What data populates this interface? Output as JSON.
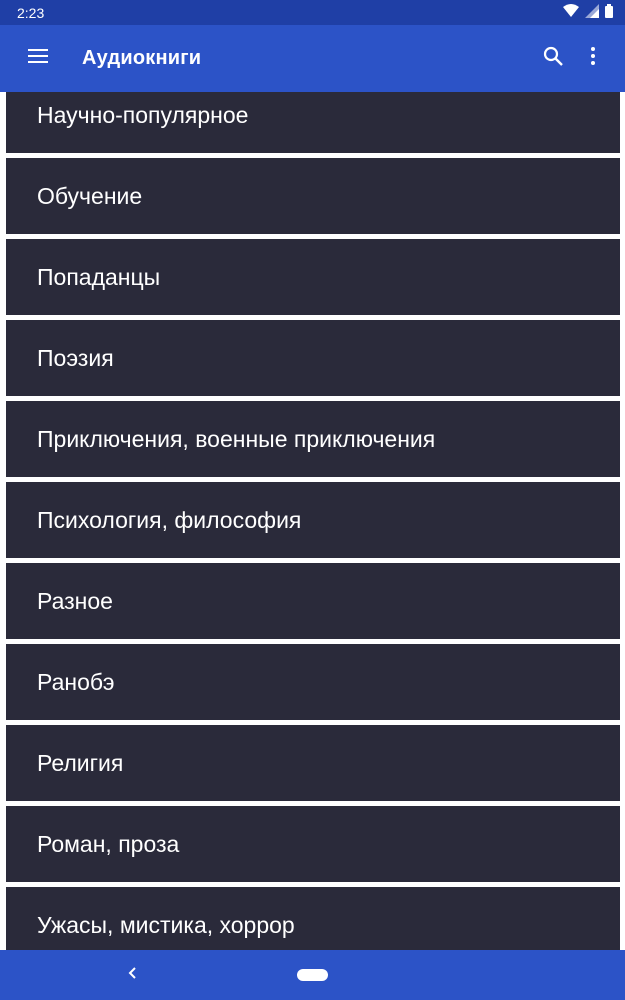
{
  "status_bar": {
    "time": "2:23"
  },
  "app_bar": {
    "menu_icon": "hamburger-menu-icon",
    "title": "Аудиокниги",
    "search_icon": "search-icon",
    "overflow_icon": "more-vertical-icon"
  },
  "genres": [
    "Научно-популярное",
    "Обучение",
    "Попаданцы",
    "Поэзия",
    "Приключения, военные приключения",
    "Психология, философия",
    "Разное",
    "Ранобэ",
    "Религия",
    "Роман, проза",
    "Ужасы, мистика, хоррор"
  ],
  "colors": {
    "app_bar": "#2c53c7",
    "status_bar": "#1f3fa6",
    "list_item_bg": "#2a2a3a",
    "list_item_text": "#ffffff"
  }
}
